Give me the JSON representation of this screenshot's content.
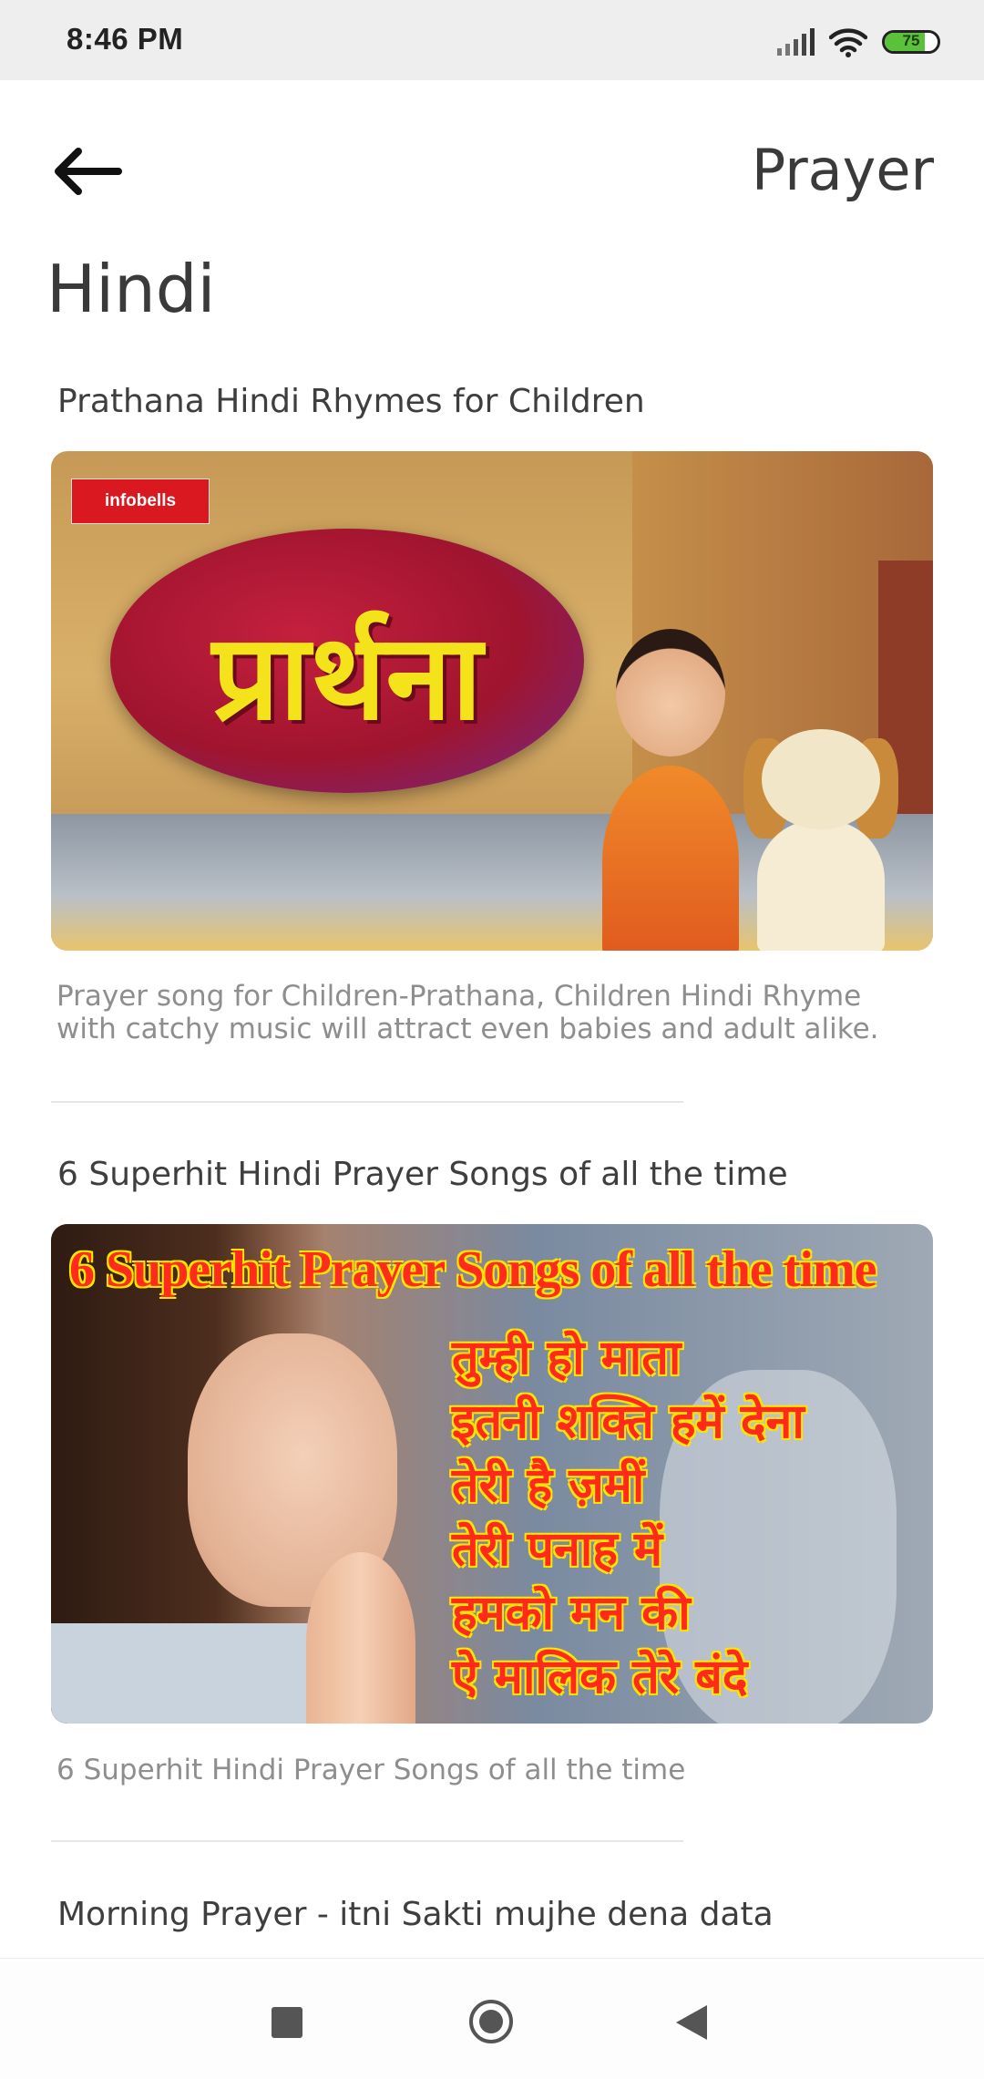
{
  "status_bar": {
    "time": "8:46 PM",
    "battery_level": "75",
    "icons": [
      "signal-icon",
      "wifi-icon",
      "battery-icon"
    ]
  },
  "header": {
    "back_icon": "arrow-left-icon",
    "title": "Prayer"
  },
  "section": {
    "title": "Hindi"
  },
  "items": [
    {
      "title": "Prathana Hindi Rhymes for Children",
      "thumbnail_logo": "infobells",
      "thumbnail_text": "प्रार्थना",
      "description_line1": "Prayer song for Children-Prathana, Children Hindi Rhyme",
      "description_line2": "with catchy music will attract even babies and adult alike."
    },
    {
      "title": "6 Superhit Hindi Prayer Songs of all the time",
      "thumbnail_headline": "6 Superhit Prayer Songs of all the time",
      "thumbnail_lines": [
        "तुम्ही हो माता",
        "इतनी शक्ति हमें देना",
        "तेरी है ज़मीं",
        "तेरी पनाह में",
        "हमको मन की",
        "ऐ मालिक तेरे बंदे"
      ],
      "description_line1": "6 Superhit Hindi Prayer Songs of all the time"
    },
    {
      "title": "Morning Prayer - itni Sakti mujhe dena data"
    }
  ],
  "nav_bar": {
    "icons": [
      "recent-apps-icon",
      "home-icon",
      "back-icon"
    ]
  },
  "colors": {
    "status_bar_bg": "#eeeeee",
    "battery_fill": "#5cc13a",
    "title_text": "#3a3a3a",
    "description_text": "#8e8e8e"
  }
}
